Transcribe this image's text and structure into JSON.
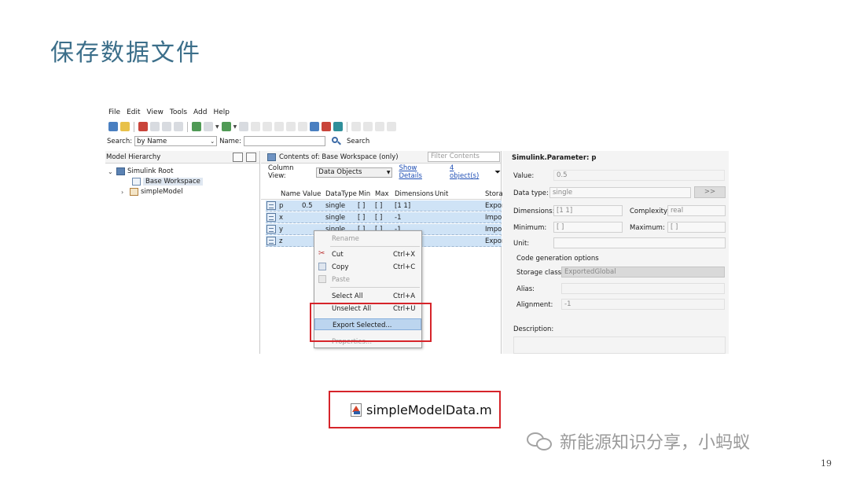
{
  "slide": {
    "title": "保存数据文件",
    "page_number": "19",
    "watermark": "新能源知识分享，小蚂蚁"
  },
  "menu": [
    "File",
    "Edit",
    "View",
    "Tools",
    "Add",
    "Help"
  ],
  "search": {
    "label": "Search:",
    "by": "by Name",
    "name_label": "Name:",
    "button": "Search"
  },
  "hierarchy": {
    "title": "Model Hierarchy",
    "root": "Simulink Root",
    "workspace": "Base Workspace",
    "model": "simpleModel"
  },
  "contents": {
    "title": "Contents of:  Base Workspace  (only)",
    "filter_placeholder": "Filter Contents",
    "column_view_label": "Column View:",
    "column_view_value": "Data Objects",
    "show_details": "Show Details",
    "object_count": "4 object(s)",
    "columns": [
      "Name",
      "Value",
      "DataType",
      "Min",
      "Max",
      "Dimensions",
      "Unit",
      "Stora"
    ],
    "rows": [
      {
        "name": "p",
        "value": "0.5",
        "datatype": "single",
        "min": "[ ]",
        "max": "[ ]",
        "dims": "[1 1]",
        "storage": "Export"
      },
      {
        "name": "x",
        "value": "",
        "datatype": "single",
        "min": "[ ]",
        "max": "[ ]",
        "dims": "-1",
        "storage": "Impor"
      },
      {
        "name": "y",
        "value": "",
        "datatype": "single",
        "min": "[ ]",
        "max": "[ ]",
        "dims": "-1",
        "storage": "Impor"
      },
      {
        "name": "z",
        "value": "",
        "datatype": "",
        "min": "",
        "max": "",
        "dims": "",
        "storage": "Export"
      }
    ]
  },
  "context_menu": {
    "rename": "Rename",
    "cut": "Cut",
    "cut_sc": "Ctrl+X",
    "copy": "Copy",
    "copy_sc": "Ctrl+C",
    "paste": "Paste",
    "select_all": "Select All",
    "select_all_sc": "Ctrl+A",
    "unselect_all": "Unselect All",
    "unselect_all_sc": "Ctrl+U",
    "export_selected": "Export Selected...",
    "properties": "Properties..."
  },
  "properties": {
    "title": "Simulink.Parameter: p",
    "value_label": "Value:",
    "value": "0.5",
    "datatype_label": "Data type:",
    "datatype": "single",
    "more_btn": ">>",
    "dimensions_label": "Dimensions:",
    "dimensions": "[1 1]",
    "complexity_label": "Complexity:",
    "complexity": "real",
    "minimum_label": "Minimum:",
    "minimum": "[ ]",
    "maximum_label": "Maximum:",
    "maximum": "[ ]",
    "unit_label": "Unit:",
    "codegen_label": "Code generation options",
    "storage_label": "Storage class:",
    "storage": "ExportedGlobal",
    "alias_label": "Alias:",
    "alignment_label": "Alignment:",
    "alignment": "-1",
    "description_label": "Description:"
  },
  "exported_file": {
    "name": "simpleModelData.m"
  }
}
